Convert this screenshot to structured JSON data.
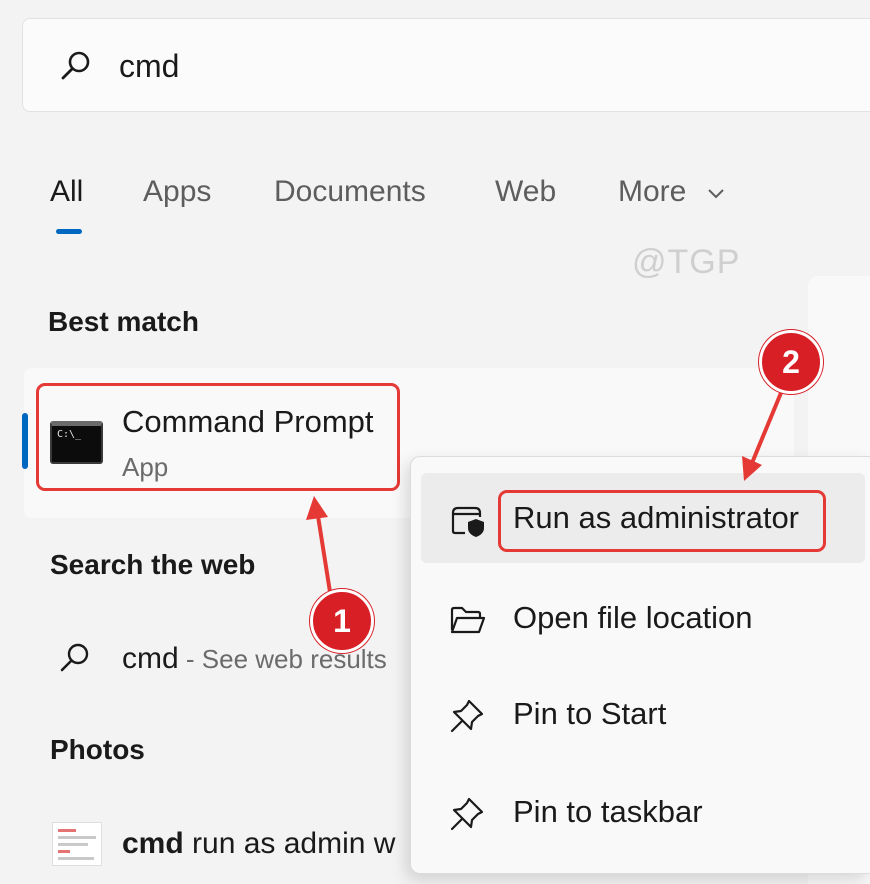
{
  "search": {
    "query": "cmd"
  },
  "tabs": [
    {
      "label": "All",
      "active": true
    },
    {
      "label": "Apps",
      "active": false
    },
    {
      "label": "Documents",
      "active": false
    },
    {
      "label": "Web",
      "active": false
    },
    {
      "label": "More",
      "active": false
    }
  ],
  "watermark": "@TGP",
  "best_match": {
    "title": "Best match",
    "app_icon_text": "C:\\_",
    "name": "Command Prompt",
    "type": "App"
  },
  "search_web": {
    "title": "Search the web",
    "query": "cmd",
    "suffix": " - See web results"
  },
  "photos": {
    "title": "Photos",
    "bold": "cmd",
    "rest": " run as admin w"
  },
  "context_menu": {
    "items": [
      {
        "label": "Run as administrator",
        "icon": "shield-icon"
      },
      {
        "label": "Open file location",
        "icon": "folder-icon"
      },
      {
        "label": "Pin to Start",
        "icon": "pin-icon"
      },
      {
        "label": "Pin to taskbar",
        "icon": "pin-icon"
      }
    ]
  },
  "annotations": {
    "step1": "1",
    "step2": "2",
    "highlight_color": "#e53935",
    "badge_color": "#d81f26"
  },
  "colors": {
    "accent": "#0067c0",
    "background": "#f3f3f3"
  }
}
